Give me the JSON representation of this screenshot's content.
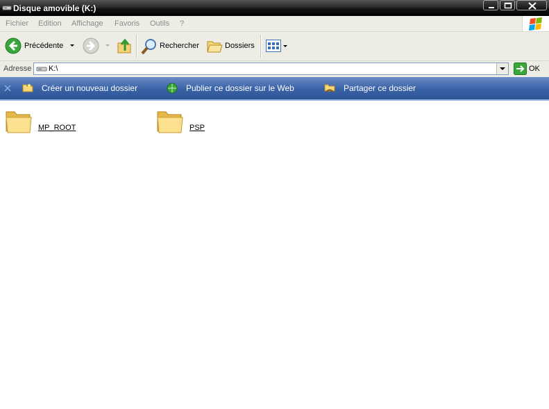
{
  "window": {
    "title": "Disque amovible (K:)",
    "icon": "removable-drive-icon",
    "controls": [
      "minimize-icon",
      "maximize-icon",
      "close-icon"
    ]
  },
  "menu": {
    "items": [
      "Fichier",
      "Edition",
      "Affichage",
      "Favoris",
      "Outils",
      "?"
    ]
  },
  "toolbar": {
    "back_label": "Précédente",
    "search_label": "Rechercher",
    "folders_label": "Dossiers"
  },
  "address": {
    "label": "Adresse",
    "value": "K:\\",
    "go_label": "OK"
  },
  "tasks": {
    "items": [
      {
        "label": "Créer un nouveau dossier",
        "icon": "new-folder-icon"
      },
      {
        "label": "Publier ce dossier sur le Web",
        "icon": "publish-web-icon"
      },
      {
        "label": "Partager ce dossier",
        "icon": "share-folder-icon"
      }
    ]
  },
  "files": [
    {
      "name": "MP_ROOT",
      "icon": "folder-icon"
    },
    {
      "name": "PSP",
      "icon": "folder-icon"
    }
  ],
  "colors": {
    "taskbar": "#3c64a8",
    "titlebar": "#151515",
    "chrome": "#eeede5"
  }
}
